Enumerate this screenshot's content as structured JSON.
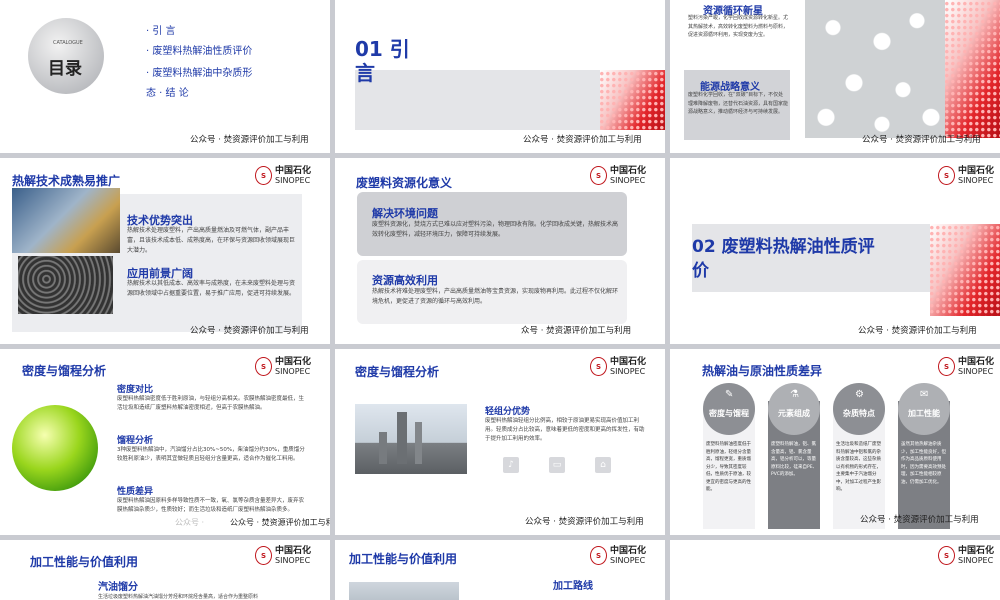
{
  "logo": {
    "cn": "中国石化",
    "en": "SINOPEC",
    "mark": "Sinopec"
  },
  "footer_text": "公众号 · 焚资源评价加工与利用",
  "footer_text_short": "公众号 · 焚资源评价加工与利",
  "footer_text_b": "众号 · 焚资源评价加工与利用",
  "footer_text_c": "公众号 · 焚资源评价加工与利",
  "slide1": {
    "catalogue": "CATALOGUE",
    "title": "目录",
    "items": [
      "· 引 言",
      "· 废塑料热解油性质评价",
      "· 废塑料热解油中杂质形",
      "态 · 结 论"
    ],
    "footer": "公众号 · 焚资源评价加工与利用"
  },
  "slide2": {
    "title_line1": "01 引",
    "title_line2": "言",
    "footer": "公众号 · 焚资源评价加工与利用"
  },
  "slide3": {
    "h1": "资源循环新星",
    "p1": "塑料污染严峻，化学回收成资源转化新星。尤其热解技术，高效转化废塑料为燃料与原料，促进资源循环利用，实现变废为宝。",
    "h2": "能源战略意义",
    "p2": "废塑料化学回收，在“双碳”目标下，不仅处理难降解废物，还替代石油资源，具有国家能源战略意义，推动循环经济与可持续发展。",
    "footer": "公众号 · 焚资源评价加工与利用"
  },
  "slide4": {
    "title": "热解技术成熟易推广",
    "h1": "技术优势突出",
    "p1": "热解技术处理废塑料，产出高质量燃油及可燃气体，副产品丰富，且该技术成本低、成熟度高，在环保与资源回收领域展现巨大潜力。",
    "h2": "应用前景广阔",
    "p2": "热解技术以其低成本、高效率与成熟度，在未来废塑料处理与资源回收领域中占据重要位置，易于推广应用，促进可持续发展。",
    "footer": "公众号 · 焚资源评价加工与利用"
  },
  "slide5": {
    "title": "废塑料资源化意义",
    "h1": "解决环境问题",
    "p1": "废塑料资源化，焚烧方式已难以应对塑料污染，物理回收有限。化学回收成关键，热解技术高效转化废塑料，减轻环境压力，保障可持续发展。",
    "h2": "资源高效利用",
    "p2": "热解技术将难处理废塑料，产出高质量燃油等宝贵资源，实现废物再利用。此过程不仅化解环境危机，更促进了资源的循环与高效利用。",
    "footer": "众号 · 焚资源评价加工与利用"
  },
  "slide6": {
    "title_line1": "02 废塑料热解油性质评",
    "title_line2": "价",
    "footer": "公众号 · 焚资源评价加工与利用"
  },
  "slide7": {
    "title": "密度与馏程分析",
    "h1": "密度对比",
    "p1": "废塑料热解油密度低于胜利原油，与轻组分高相关。农膜热解油密度最低，生活垃圾和造纸厂废塑料热解油密度相近，但高于农膜热解油。",
    "h2": "馏程分析",
    "p2": "3种废塑料热解油中，汽油馏分占比30%~50%，柴油馏分约30%，重质馏分较胜利原油少，表明其宜做轻质且轻组分含量更高，适合作为催化工料用。",
    "h3": "性质差异",
    "p3": "废塑料热解油因原料多样导致性质不一致，氧、氯等杂质含量差异大，废弃农膜热解油杂质少，性质较好；而生活垃圾和造纸厂废塑料热解油杂质多。",
    "footer": "公众号 · 焚资源评价加工与利用",
    "watermark": "公众号 ·"
  },
  "slide8": {
    "title": "密度与馏程分析",
    "h1": "轻组分优势",
    "p1": "废塑料热解油轻组分比例高，相较于原油更易实现高价值加工利用。轻质成分占比较高，意味着更低的密度和更高的挥发性，有助于提升加工利用的效率。",
    "footer": "公众号 · 焚资源评价加工与利用"
  },
  "slide9": {
    "title": "热解油与原油性质差异",
    "cards": [
      {
        "label": "密度与馏程",
        "icon": "feather-icon",
        "text": "废塑料热解油密度低于胜利原油，轻组分含量高，馏程更宽，重质馏分少，导致其密度较低，性质优于原油，较更宜的密度与更高的性能。"
      },
      {
        "label": "元素组成",
        "icon": "flask-icon",
        "text": "废塑料热解油，铝、氯含量高，铝、氯含量高，铝分析可以，等量原料比较，硅来自PE、PVC的添加。"
      },
      {
        "label": "杂质特点",
        "icon": "gear-icon",
        "text": "生活垃圾和造纸厂废塑料热解油中铝和氯的杂质含量较高，这些杂质以有机物的形式存在，主要集中于汽油馏分中，对加工过程产生影响。"
      },
      {
        "label": "加工性能",
        "icon": "chat-icon",
        "text": "虽然其他热解油杂质少，加工性能良好，但作为高品质原料使用时，因为需要高效预处理，加工性能相较原油，仍需加工优化。"
      }
    ],
    "footer": "公众号 · 焚资源评价加工与利用"
  },
  "slide10": {
    "title": "加工性能与价值利用",
    "h1": "汽油馏分",
    "p1": "生活垃圾废塑料热解油汽油馏分芳烃和环烷烃含量高，适合作为重整原料"
  },
  "slide11": {
    "title": "加工性能与价值利用",
    "h1": "加工路线"
  }
}
